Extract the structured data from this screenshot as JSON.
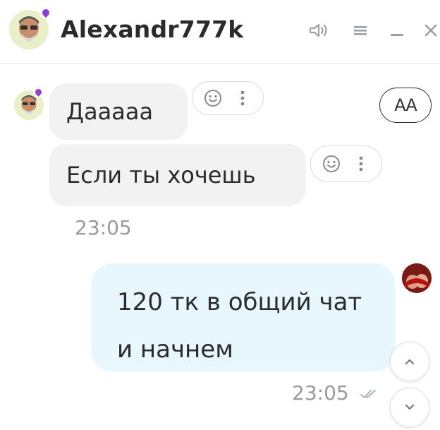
{
  "header": {
    "title": "Alexandr777k",
    "icons": [
      "speaker-icon",
      "menu-icon",
      "minimize-icon",
      "close-icon"
    ]
  },
  "messages": {
    "incoming": [
      {
        "text": "Даааaa"
      },
      {
        "text": "Если ты хочешь"
      }
    ],
    "incoming_time": "23:05",
    "outgoing": {
      "lines": [
        "120 тк в общий чат",
        "и начнем"
      ],
      "time": "23:05"
    }
  },
  "controls": {
    "font_size_label": "AA"
  },
  "colors": {
    "incoming_bubble": "#f2f2f2",
    "outgoing_bubble": "#e8f6fd",
    "online_badge": "#8e3fd1",
    "title_text": "#2b2b2b",
    "timestamp": "#9a9a9a"
  }
}
